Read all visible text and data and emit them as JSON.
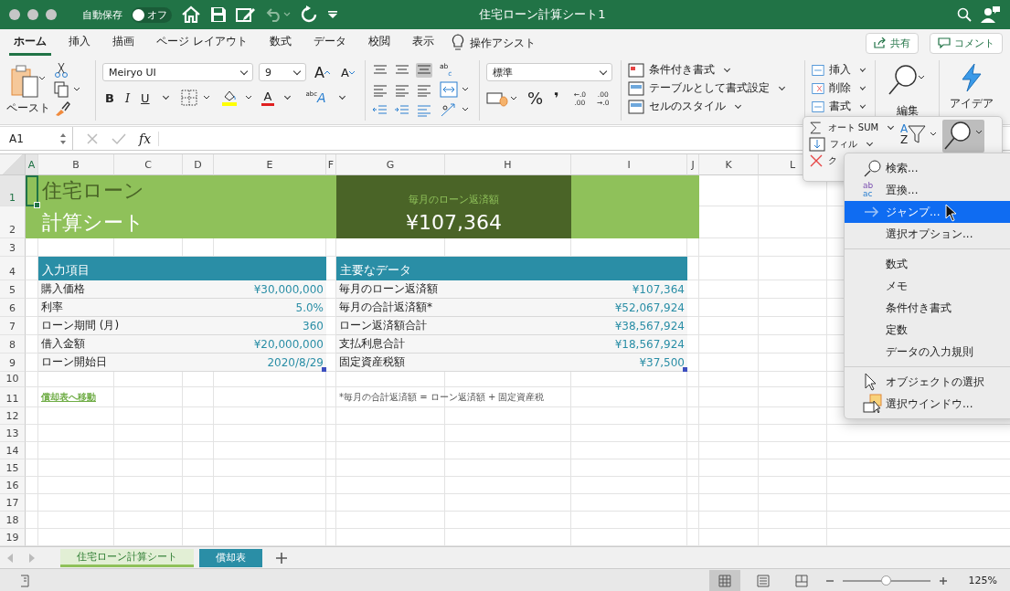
{
  "window": {
    "title": "住宅ローン計算シート1",
    "autosave_label": "自動保存",
    "autosave": {
      "on": false,
      "label": "オフ"
    }
  },
  "ribbon_tabs": [
    {
      "label": "ホーム",
      "selected": true
    },
    {
      "label": "挿入",
      "selected": false
    },
    {
      "label": "描画",
      "selected": false
    },
    {
      "label": "ページ レイアウト",
      "selected": false
    },
    {
      "label": "数式",
      "selected": false
    },
    {
      "label": "データ",
      "selected": false
    },
    {
      "label": "校閲",
      "selected": false
    },
    {
      "label": "表示",
      "selected": false
    }
  ],
  "tell_me": "操作アシスト",
  "share_button": "共有",
  "comment_button": "コメント",
  "clipboard": {
    "paste_label": "ペースト"
  },
  "font": {
    "name": "Meiryo UI",
    "size": "9",
    "grow": "A",
    "shrink": "A",
    "bold": "B",
    "italic": "I",
    "underline": "U",
    "font_color": "A",
    "phonetic": [
      "abc",
      "A"
    ]
  },
  "alignment": {
    "wrap_text": [
      "ab",
      "c"
    ]
  },
  "number": {
    "format": "標準",
    "percent": "%",
    "comma": "❜",
    "add_decimal": [
      "←.0",
      ".00"
    ],
    "remove_decimal": [
      ".00",
      "→.0"
    ]
  },
  "styles": [
    "条件付き書式",
    "テーブルとして書式設定",
    "セルのスタイル"
  ],
  "cells": [
    "挿入",
    "削除",
    "書式"
  ],
  "editing_label": "編集",
  "ideas_label": "アイデア",
  "formula_bar": {
    "name_box": "A1",
    "fx": "fx"
  },
  "columns": [
    {
      "label": "A",
      "selected": true
    },
    {
      "label": "B",
      "selected": false
    },
    {
      "label": "C",
      "selected": false
    },
    {
      "label": "D",
      "selected": false
    },
    {
      "label": "E",
      "selected": false
    },
    {
      "label": "F",
      "selected": false
    },
    {
      "label": "G",
      "selected": false
    },
    {
      "label": "H",
      "selected": false
    },
    {
      "label": "I",
      "selected": false
    },
    {
      "label": "J",
      "selected": false
    },
    {
      "label": "K",
      "selected": false
    },
    {
      "label": "L",
      "selected": false
    }
  ],
  "rows": [
    {
      "label": "1",
      "selected": true
    },
    {
      "label": "2",
      "selected": false
    },
    {
      "label": "3",
      "selected": false
    },
    {
      "label": "4",
      "selected": false
    },
    {
      "label": "5",
      "selected": false
    },
    {
      "label": "6",
      "selected": false
    },
    {
      "label": "7",
      "selected": false
    },
    {
      "label": "8",
      "selected": false
    },
    {
      "label": "9",
      "selected": false
    },
    {
      "label": "10",
      "selected": false
    },
    {
      "label": "11",
      "selected": false
    },
    {
      "label": "12",
      "selected": false
    },
    {
      "label": "13",
      "selected": false
    },
    {
      "label": "14",
      "selected": false
    },
    {
      "label": "15",
      "selected": false
    },
    {
      "label": "16",
      "selected": false
    },
    {
      "label": "17",
      "selected": false
    },
    {
      "label": "18",
      "selected": false
    },
    {
      "label": "19",
      "selected": false
    }
  ],
  "sheet": {
    "title_lines": [
      "住宅ローン",
      "計算シート"
    ],
    "hero_label": "毎月のローン返済額",
    "hero_value": "¥107,364",
    "inputs": {
      "header": "入力項目",
      "rows": [
        {
          "label": "購入価格",
          "value": "¥30,000,000"
        },
        {
          "label": "利率",
          "value": "5.0%"
        },
        {
          "label": "ローン期間 (月)",
          "value": "360"
        },
        {
          "label": "借入金額",
          "value": "¥20,000,000"
        },
        {
          "label": "ローン開始日",
          "value": "2020/8/29"
        }
      ]
    },
    "key_data": {
      "header": "主要なデータ",
      "rows": [
        {
          "label": "毎月のローン返済額",
          "value": "¥107,364"
        },
        {
          "label": "毎月の合計返済額*",
          "value": "¥52,067,924"
        },
        {
          "label": "ローン返済額合計",
          "value": "¥38,567,924"
        },
        {
          "label": "支払利息合計",
          "value": "¥18,567,924"
        },
        {
          "label": "固定資産税額",
          "value": "¥37,500"
        }
      ]
    },
    "link": "償却表へ移動",
    "footnote": "*毎月の合計返済額 = ローン返済額 + 固定資産税"
  },
  "editing_popover": {
    "autosum": "オート SUM",
    "fill": "フィル",
    "clear": "ク",
    "sort": [
      "A",
      "Z"
    ]
  },
  "find_menu": {
    "replace_glyph": [
      "ab",
      "ac"
    ],
    "sections": [
      [
        {
          "label": "検索...",
          "selected": false
        },
        {
          "label": "置換...",
          "selected": false
        },
        {
          "label": "ジャンプ...",
          "selected": true
        },
        {
          "label": "選択オプション...",
          "selected": false
        }
      ],
      [
        {
          "label": "数式",
          "selected": false
        },
        {
          "label": "メモ",
          "selected": false
        },
        {
          "label": "条件付き書式",
          "selected": false
        },
        {
          "label": "定数",
          "selected": false
        },
        {
          "label": "データの入力規則",
          "selected": false
        }
      ],
      [
        {
          "label": "オブジェクトの選択",
          "selected": false
        },
        {
          "label": "選択ウインドウ...",
          "selected": false
        }
      ]
    ]
  },
  "sheet_tabs": [
    {
      "label": "住宅ローン計算シート",
      "selected": true,
      "color": "#8fc15a"
    },
    {
      "label": "償却表",
      "selected": false,
      "color": "#2a8ea6"
    }
  ],
  "zoom": {
    "level": 0.5,
    "label": "125%"
  }
}
